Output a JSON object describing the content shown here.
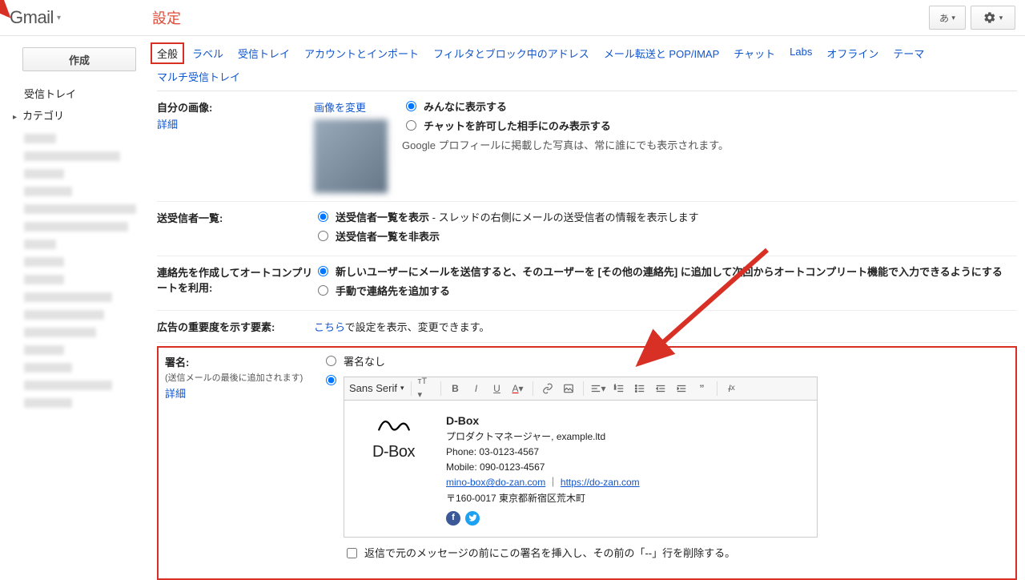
{
  "brand": "Gmail",
  "page_title": "設定",
  "top": {
    "ime_label": "あ",
    "gear": "▾"
  },
  "sidebar": {
    "compose": "作成",
    "items": [
      "受信トレイ",
      "カテゴリ"
    ]
  },
  "tabs": [
    "全般",
    "ラベル",
    "受信トレイ",
    "アカウントとインポート",
    "フィルタとブロック中のアドレス",
    "メール転送と POP/IMAP",
    "チャット",
    "Labs",
    "オフライン",
    "テーマ",
    "マルチ受信トレイ"
  ],
  "sections": {
    "image": {
      "label": "自分の画像:",
      "detail": "詳細",
      "change_link": "画像を変更",
      "opt1": "みんなに表示する",
      "opt2": "チャットを許可した相手にのみ表示する",
      "note": "Google プロフィールに掲載した写真は、常に誰にでも表示されます。"
    },
    "people": {
      "label": "送受信者一覧:",
      "opt1_bold": "送受信者一覧を表示",
      "opt1_rest": " - スレッドの右側にメールの送受信者の情報を表示します",
      "opt2": "送受信者一覧を非表示"
    },
    "autocomplete": {
      "label": "連絡先を作成してオートコンプリートを利用:",
      "opt1": "新しいユーザーにメールを送信すると、そのユーザーを [その他の連絡先] に追加して次回からオートコンプリート機能で入力できるようにする",
      "opt2": "手動で連絡先を追加する"
    },
    "ads": {
      "label": "広告の重要度を示す要素:",
      "link": "こちら",
      "rest": "で設定を表示、変更できます。"
    },
    "signature": {
      "label": "署名:",
      "sub": "(送信メールの最後に追加されます)",
      "detail": "詳細",
      "opt_none": "署名なし",
      "editor": {
        "font": "Sans Serif",
        "sig_name": "D-Box",
        "role": "プロダクトマネージャー,  example.ltd",
        "phone": "Phone: 03-0123-4567",
        "mobile": "Mobile: 090-0123-4567",
        "email": "mino-box@do-zan.com",
        "url": "https://do-zan.com",
        "address": "〒160-0017 東京都新宿区荒木町",
        "logo_name": "D-Box"
      },
      "insert_checkbox": "返信で元のメッセージの前にこの署名を挿入し、その前の「--」行を削除する。"
    }
  }
}
